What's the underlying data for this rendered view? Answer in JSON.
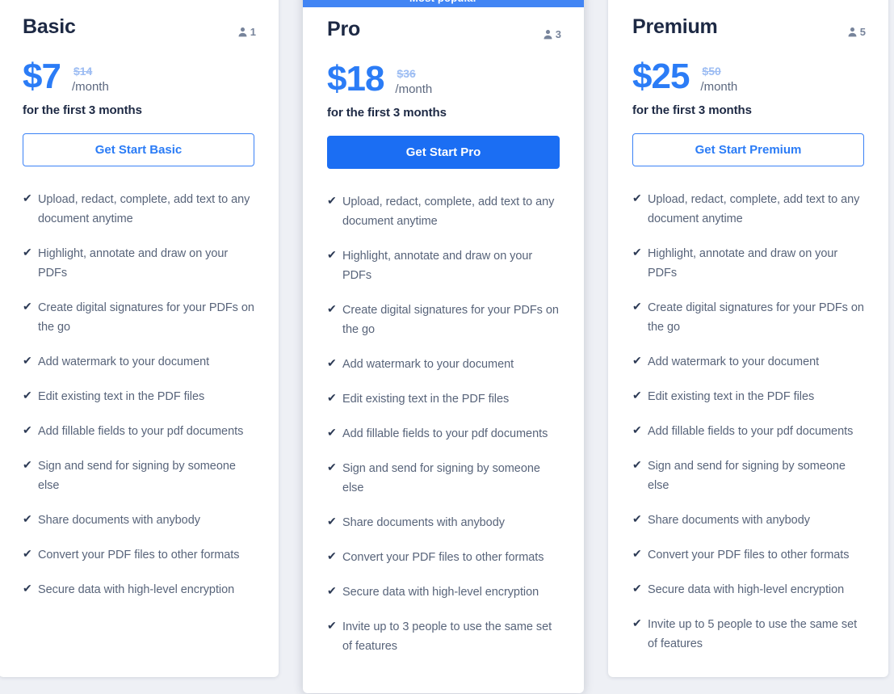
{
  "page": {
    "background_color": "#eef0f5",
    "accent_color": "#2b7cf6",
    "solid_button_color": "#1b6ef3",
    "ribbon_color": "#4285f4",
    "heading_color": "#1d2944",
    "feature_text_color": "#58647a"
  },
  "plans": [
    {
      "id": "basic",
      "name": "Basic",
      "seats": "1",
      "seats_icon": "user-icon",
      "price_now": "$7",
      "price_old": "$14",
      "price_period": "/month",
      "price_note": "for the first 3 months",
      "cta_label": "Get Start Basic",
      "cta_style": "outline",
      "ribbon": null,
      "features": [
        "Upload, redact, complete, add text to any document anytime",
        "Highlight, annotate and draw on your PDFs",
        "Create digital signatures for your PDFs on the go",
        "Add watermark to your document",
        "Edit existing text in the PDF files",
        "Add fillable fields to your pdf documents",
        "Sign and send for signing by someone else",
        "Share documents with anybody",
        "Convert your PDF files to other formats",
        "Secure data with high-level encryption"
      ]
    },
    {
      "id": "pro",
      "name": "Pro",
      "seats": "3",
      "seats_icon": "user-icon",
      "price_now": "$18",
      "price_old": "$36",
      "price_period": "/month",
      "price_note": "for the first 3 months",
      "cta_label": "Get Start Pro",
      "cta_style": "solid",
      "ribbon": "Most popular",
      "features": [
        "Upload, redact, complete, add text to any document anytime",
        "Highlight, annotate and draw on your PDFs",
        "Create digital signatures for your PDFs on the go",
        "Add watermark to your document",
        "Edit existing text in the PDF files",
        "Add fillable fields to your pdf documents",
        "Sign and send for signing by someone else",
        "Share documents with anybody",
        "Convert your PDF files to other formats",
        "Secure data with high-level encryption",
        "Invite up to 3 people to use the same set of features"
      ]
    },
    {
      "id": "premium",
      "name": "Premium",
      "seats": "5",
      "seats_icon": "user-icon",
      "price_now": "$25",
      "price_old": "$50",
      "price_period": "/month",
      "price_note": "for the first 3 months",
      "cta_label": "Get Start Premium",
      "cta_style": "outline",
      "ribbon": null,
      "features": [
        "Upload, redact, complete, add text to any document anytime",
        "Highlight, annotate and draw on your PDFs",
        "Create digital signatures for your PDFs on the go",
        "Add watermark to your document",
        "Edit existing text in the PDF files",
        "Add fillable fields to your pdf documents",
        "Sign and send for signing by someone else",
        "Share documents with anybody",
        "Convert your PDF files to other formats",
        "Secure data with high-level encryption",
        "Invite up to 5 people to use the same set of features"
      ]
    }
  ]
}
